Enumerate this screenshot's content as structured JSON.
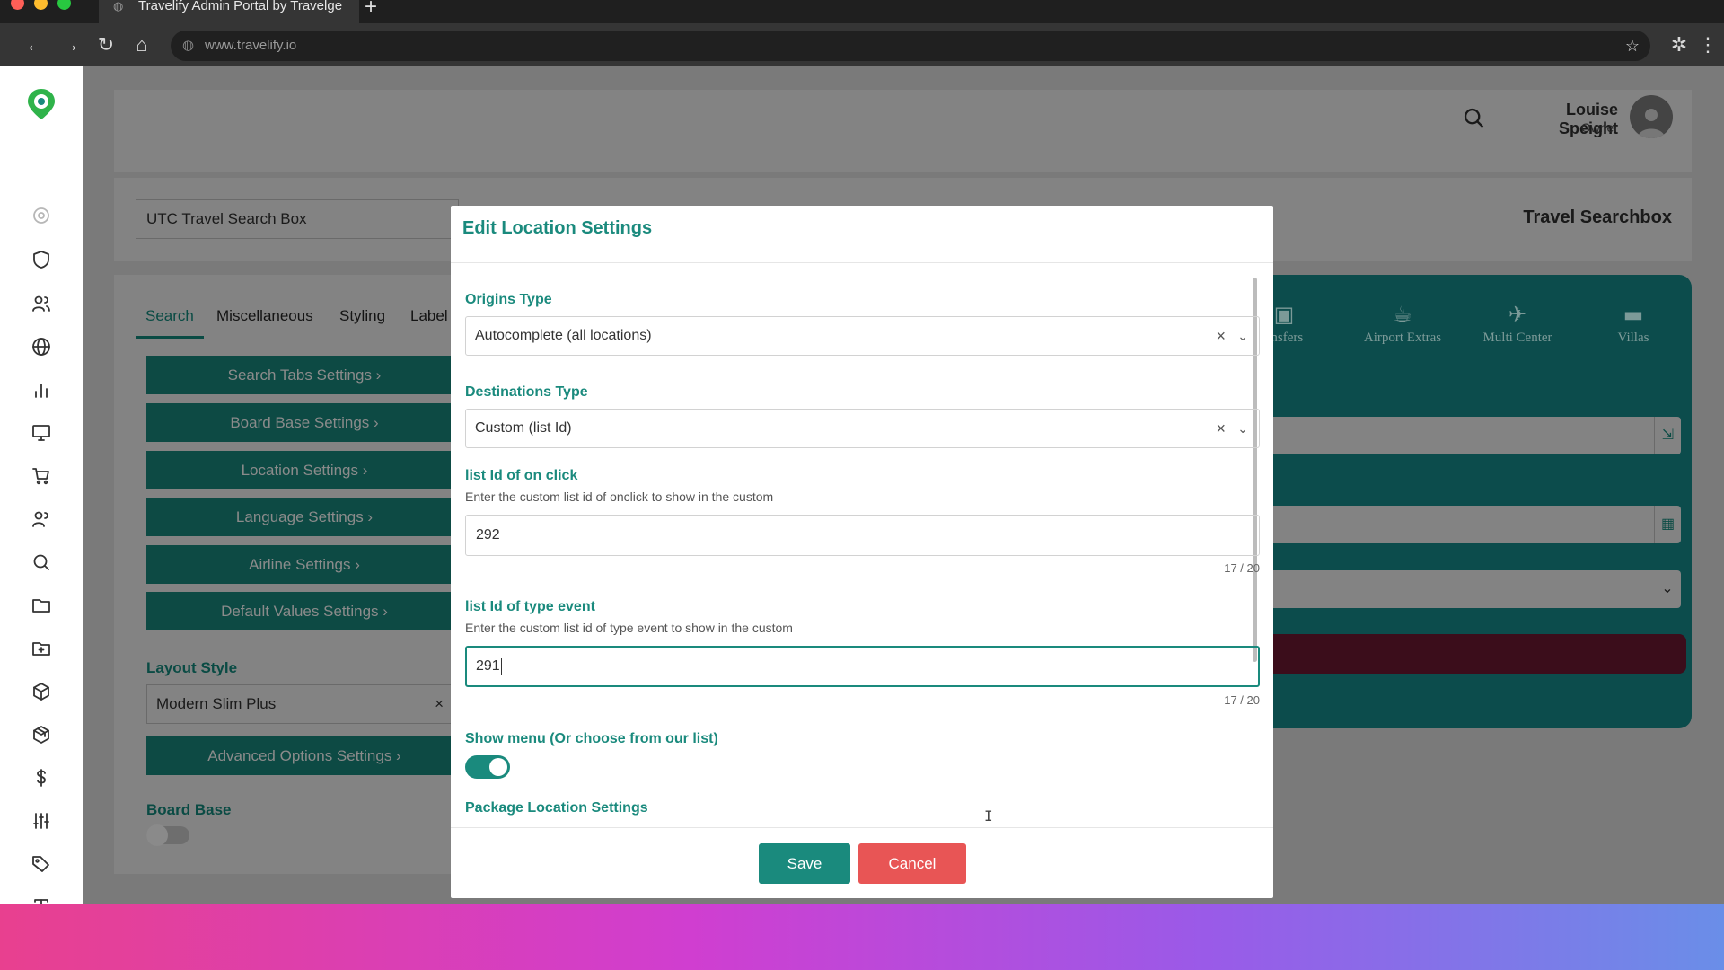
{
  "browser": {
    "tab_title": "Travelify Admin Portal by Travelge",
    "new_tab": "+",
    "url": "www.travelify.io"
  },
  "header": {
    "user_name": "Louise Speight",
    "user_role": "Owner"
  },
  "toolbox_name": "UTC Travel Search Box",
  "page_title": "Travel Searchbox",
  "left_panel": {
    "tabs": [
      "Search",
      "Miscellaneous",
      "Styling",
      "Label"
    ],
    "settings_buttons": [
      "Search Tabs Settings  ›",
      "Board Base Settings  ›",
      "Location Settings  ›",
      "Language Settings  ›",
      "Airline Settings  ›",
      "Default Values Settings  ›"
    ],
    "layout_style_label": "Layout Style",
    "layout_style_value": "Modern Slim Plus",
    "layout_clear": "×",
    "advanced_button": "Advanced Options Settings  ›",
    "board_base_label": "Board Base"
  },
  "right_panel": {
    "tabs": [
      {
        "label": "ansfers",
        "icon": "bus-icon"
      },
      {
        "label": "Airport Extras",
        "icon": "coffee-icon"
      },
      {
        "label": "Multi Center",
        "icon": "plane-icon"
      },
      {
        "label": "Villas",
        "icon": "bed-icon"
      }
    ]
  },
  "modal": {
    "title": "Edit Location Settings",
    "origins_label": "Origins Type",
    "origins_value": "Autocomplete (all locations)",
    "destinations_label": "Destinations Type",
    "destinations_value": "Custom (list Id)",
    "onclick_label": "list Id of on click",
    "onclick_hint": "Enter the custom list id of onclick to show in the custom",
    "onclick_value": "292",
    "onclick_counter": "17 / 20",
    "typeevent_label": "list Id of type event",
    "typeevent_hint": "Enter the custom list id of type event to show in the custom",
    "typeevent_value": "291",
    "typeevent_counter": "17 / 20",
    "show_menu_label": "Show menu (Or choose from our list)",
    "show_menu_on": true,
    "package_label": "Package Location Settings",
    "clear_symbol": "×",
    "chevron_symbol": "⌄",
    "save_label": "Save",
    "cancel_label": "Cancel"
  },
  "colors": {
    "accent": "#1a8a7d",
    "cancel": "#e85555",
    "overlay_bg": "#7a7a7a"
  }
}
